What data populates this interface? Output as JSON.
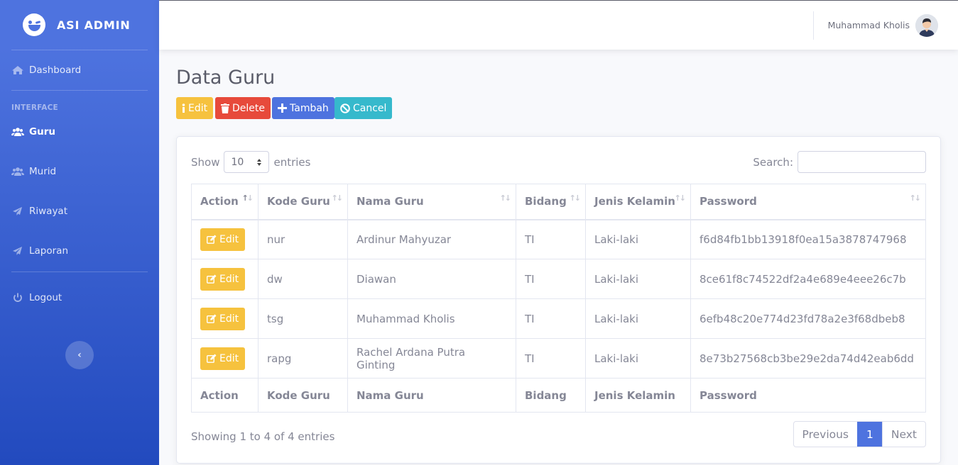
{
  "brand": {
    "name": "ASI ADMIN",
    "logo_icon": "laugh-wink-icon"
  },
  "sidebar": {
    "dashboard": "Dashboard",
    "heading": "INTERFACE",
    "items": [
      {
        "label": "Guru",
        "icon": "users-icon",
        "active": true
      },
      {
        "label": "Murid",
        "icon": "users-icon",
        "active": false
      },
      {
        "label": "Riwayat",
        "icon": "paper-plane-icon",
        "active": false
      },
      {
        "label": "Laporan",
        "icon": "paper-plane-icon",
        "active": false
      }
    ],
    "logout": "Logout",
    "toggle_glyph": "‹"
  },
  "topbar": {
    "user_name": "Muhammad Kholis"
  },
  "page": {
    "title": "Data Guru",
    "buttons": {
      "edit": "Edit",
      "delete": "Delete",
      "add": "Tambah",
      "cancel": "Cancel"
    }
  },
  "table_controls": {
    "show": "Show",
    "entries_value": "10",
    "entries": "entries",
    "search_label": "Search:",
    "search_value": ""
  },
  "table": {
    "columns": [
      "Action",
      "Kode Guru",
      "Nama Guru",
      "Bidang",
      "Jenis Kelamin",
      "Password"
    ],
    "row_action": "Edit",
    "rows": [
      {
        "kode": "nur",
        "nama": "Ardinur Mahyuzar",
        "bidang": "TI",
        "jk": "Laki-laki",
        "password": "f6d84fb1bb13918f0ea15a3878747968"
      },
      {
        "kode": "dw",
        "nama": "Diawan",
        "bidang": "TI",
        "jk": "Laki-laki",
        "password": "8ce61f8c74522df2a4e689e4eee26c7b"
      },
      {
        "kode": "tsg",
        "nama": "Muhammad Kholis",
        "bidang": "TI",
        "jk": "Laki-laki",
        "password": "6efb48c20e774d23fd78a2e3f68dbeb8"
      },
      {
        "kode": "rapg",
        "nama": "Rachel Ardana Putra Ginting",
        "bidang": "TI",
        "jk": "Laki-laki",
        "password": "8e73b27568cb3be29e2da74d42eab6dd"
      }
    ]
  },
  "footer": {
    "info": "Showing 1 to 4 of 4 entries",
    "previous": "Previous",
    "page": "1",
    "next": "Next"
  },
  "colors": {
    "primary": "#4e73df",
    "warning": "#f6c23e",
    "danger": "#e74a3b",
    "info": "#36b9cc"
  }
}
